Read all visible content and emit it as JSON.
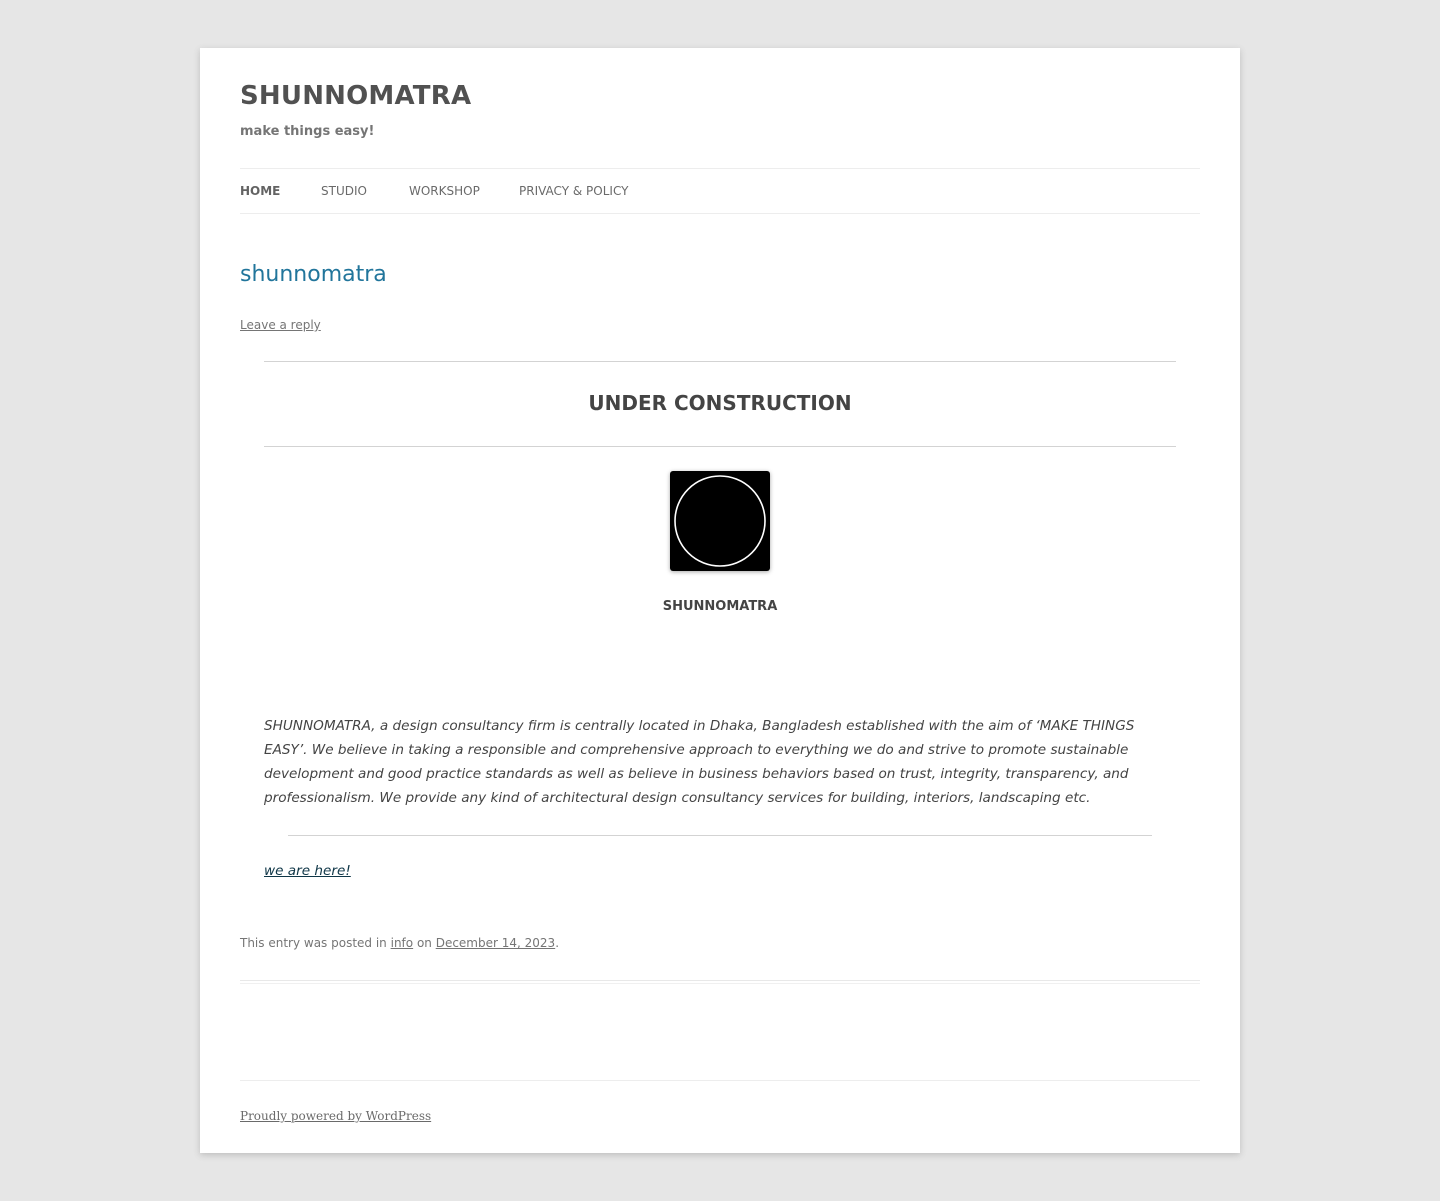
{
  "header": {
    "site_title": "SHUNNOMATRA",
    "tagline": "make things easy!"
  },
  "nav": {
    "items": [
      {
        "label": "HOME",
        "current": true
      },
      {
        "label": "STUDIO",
        "current": false
      },
      {
        "label": "WORKSHOP",
        "current": false
      },
      {
        "label": "PRIVACY & POLICY",
        "current": false
      }
    ]
  },
  "post": {
    "title": "shunnomatra",
    "leave_reply": "Leave a reply",
    "heading": "UNDER CONSTRUCTION",
    "logo_caption": "SHUNNOMATRA",
    "body": "SHUNNOMATRA, a design consultancy firm is centrally located in Dhaka, Bangladesh established with the aim of ‘MAKE THINGS EASY’. We believe in taking a responsible and comprehensive approach to everything we do and strive to promote sustainable development and good practice standards as well as believe in business behaviors based on trust, integrity, transparency, and professionalism. We provide any kind of architectural design consultancy services for building, interiors, landscaping etc.",
    "link_text": "we are here!",
    "meta": {
      "prefix": "This entry was posted in ",
      "category": "info",
      "on": " on ",
      "date": "December 14, 2023",
      "suffix": "."
    }
  },
  "footer": {
    "credit": "Proudly powered by WordPress"
  },
  "colors": {
    "page_background": "#e6e6e6",
    "site_background": "#ffffff",
    "entry_title": "#21759b",
    "body_text": "#444444",
    "muted_text": "#757575"
  }
}
